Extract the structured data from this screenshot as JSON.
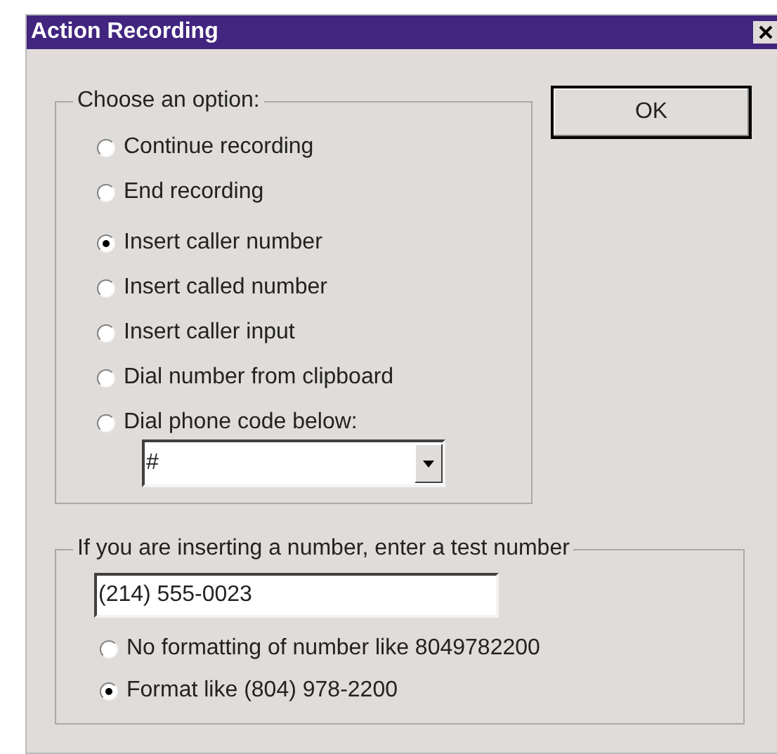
{
  "window": {
    "title": "Action Recording"
  },
  "ok_button": "OK",
  "options_group": {
    "label": "Choose an option:",
    "options": [
      {
        "label": "Continue recording",
        "selected": false
      },
      {
        "label": "End recording",
        "selected": false
      },
      {
        "label": "Insert caller number",
        "selected": true
      },
      {
        "label": "Insert called number",
        "selected": false
      },
      {
        "label": "Insert caller input",
        "selected": false
      },
      {
        "label": "Dial number from clipboard",
        "selected": false
      },
      {
        "label": "Dial phone code below:",
        "selected": false
      }
    ],
    "phone_code": {
      "value": "#"
    }
  },
  "test_group": {
    "label": "If you are inserting a number, enter a test number",
    "test_number": "(214) 555-0023",
    "formats": [
      {
        "label": "No formatting of number like 8049782200",
        "selected": false
      },
      {
        "label": "Format like (804) 978-2200",
        "selected": true
      }
    ]
  }
}
